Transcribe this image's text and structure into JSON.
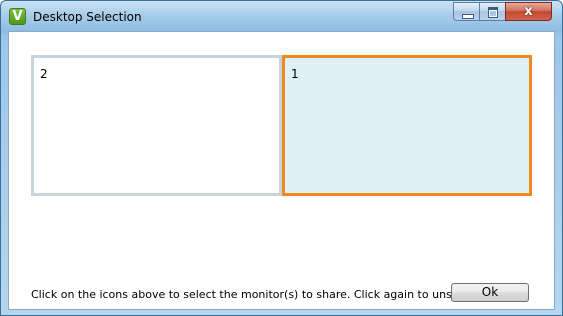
{
  "window": {
    "title": "Desktop Selection",
    "app_icon_letter": "V",
    "close_glyph": "x",
    "accent_color": "#f08a1c",
    "selected_fill": "#dff0f6",
    "unselected_border": "#c8d3dc"
  },
  "monitors": [
    {
      "label": "2",
      "selected": false
    },
    {
      "label": "1",
      "selected": true
    }
  ],
  "footer": {
    "instructions": "Click on the icons above to select the monitor(s) to share. Click again to unselect.",
    "ok_label": "Ok"
  }
}
